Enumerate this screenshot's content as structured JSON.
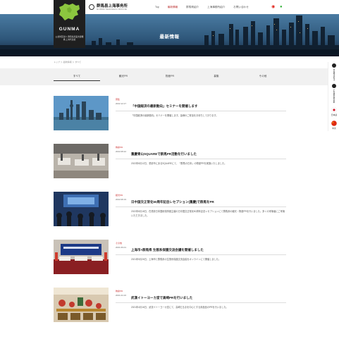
{
  "brand": {
    "name": "GUNMA",
    "sub": "公益財団法人 群馬県産業支援機構 上海代表処",
    "office_name": "群馬县上海事务所",
    "office_en": "GUNMA SHANGHAI OFFICE"
  },
  "nav": [
    {
      "label": "Top",
      "active": false
    },
    {
      "label": "最新情報",
      "active": true
    },
    {
      "label": "群馬県紹介",
      "active": false
    },
    {
      "label": "上海事務所紹介",
      "active": false
    },
    {
      "label": "お問い合わせ",
      "active": false
    }
  ],
  "sns": [
    {
      "icon": "weibo-icon",
      "glyph": "◉",
      "color": "#e0261d"
    },
    {
      "icon": "wechat-icon",
      "glyph": "●",
      "color": "#36b23b"
    }
  ],
  "hero": {
    "title": "最新情報"
  },
  "breadcrumb": "トップ ＞ 最新情報 ＞ すべて",
  "tabs": [
    "すべて",
    "観光PR",
    "物産PR",
    "募集",
    "その他"
  ],
  "news": [
    {
      "category": "募集",
      "date": "2022.12.27",
      "title": "「中国経済の最新動向」セミナーを開催します",
      "desc": "「中国経済の最新動向」セミナーを開催します。皆様のご参加をお待ちしております。"
    },
    {
      "category": "物産PR",
      "date": "2022.08.22",
      "title": "重慶青山SQUAREで群馬PR活動を行いました",
      "desc": "2022年8月12日、重慶市にあるSQUAREにて、「群馬の日本」の物産PRを実施いたしました。"
    },
    {
      "category": "観光PR",
      "date": "2022.08.19",
      "title": "日中国交正常化50周年記念レセプション(重慶)で群馬をPR",
      "desc": "2022年8月18日、在重慶日本国総領事館主催の日中国交正常化50周年記念レセプションにて群馬県の観光・物産PRを行いました。多くの来場者にご来場いただきました。"
    },
    {
      "category": "その他",
      "date": "2021.06.01",
      "title": "上海市×群馬県 生態系保護交流会議を開催しました",
      "desc": "2021年5月26日、上海市と群馬県の生態系保護交流会議をオンラインにて開催しました。"
    },
    {
      "category": "物産PR",
      "date": "2021.04.16",
      "title": "武漢イトーヨーカ堂で高崎PRを行いました",
      "desc": "2021年4月16日、武漢イトーヨーカ堂にて、高崎だるまを中心とする県産品のPRを行いました。"
    }
  ],
  "sidebar": {
    "contact": "CONTACT",
    "language": "LANGUAGE",
    "lang_ja": "日本語",
    "lang_zh": "中文"
  },
  "colors": {
    "accent": "#c33333",
    "brand_bg": "#1f1f1f",
    "map_green": "#8cc63f"
  }
}
